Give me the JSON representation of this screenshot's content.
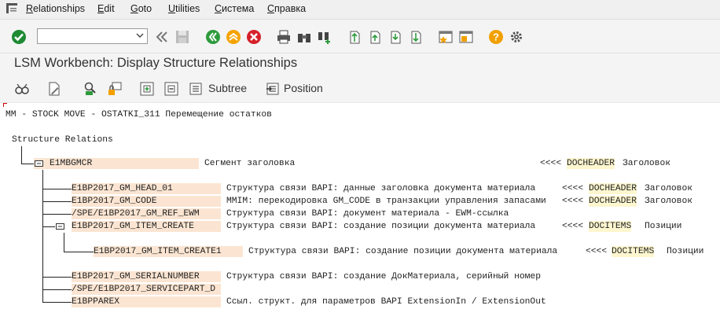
{
  "menu": {
    "items": [
      "Relationships",
      "Edit",
      "Goto",
      "Utilities",
      "Система",
      "Справка"
    ]
  },
  "toolbar": {
    "command_field": ""
  },
  "page": {
    "title": "LSM Workbench: Display Structure Relationships"
  },
  "app_toolbar": {
    "subtree_label": "Subtree",
    "position_label": "Position"
  },
  "content": {
    "header": "MM - STOCK MOVE - OSTATKI_311 Перемещение остатков",
    "section_title": "Structure Relations",
    "root": {
      "name": "E1MBGMCR",
      "desc": "Сегмент заголовка",
      "arrow": "<<<<",
      "target": "DOCHEADER",
      "target_desc": "Заголовок"
    },
    "children": [
      {
        "name": "E1BP2017_GM_HEAD_01",
        "desc": "Структура связи BAPI: данные заголовка документа материала",
        "arrow": "<<<<",
        "target": "DOCHEADER",
        "target_desc": "Заголовок"
      },
      {
        "name": "E1BP2017_GM_CODE",
        "desc": "MMIM: перекодировка GM_CODE в транзакции управления запасами",
        "arrow": "<<<<",
        "target": "DOCHEADER",
        "target_desc": "Заголовок"
      },
      {
        "name": "/SPE/E1BP2017_GM_REF_EWM",
        "desc": "Структура связи BAPI: документ материала - EWM-ссылка",
        "arrow": "",
        "target": "",
        "target_desc": ""
      },
      {
        "name": "E1BP2017_GM_ITEM_CREATE",
        "desc": "Структура связи BAPI: создание позиции документа материала",
        "arrow": "<<<<",
        "target": "DOCITEMS",
        "target_desc": "Позиции"
      },
      {
        "name": "E1BP2017_GM_ITEM_CREATE1",
        "desc": "Структура связи BAPI: создание позиции документа материала",
        "arrow": "<<<<",
        "target": "DOCITEMS",
        "target_desc": "Позиции"
      },
      {
        "name": "E1BP2017_GM_SERIALNUMBER",
        "desc": "Структура связи BAPI: создание ДокМатериала, серийный номер",
        "arrow": "",
        "target": "",
        "target_desc": ""
      },
      {
        "name": "/SPE/E1BP2017_SERVICEPART_D",
        "desc": "",
        "arrow": "",
        "target": "",
        "target_desc": ""
      },
      {
        "name": "E1BPPAREX",
        "desc": "Ссыл. структ. для параметров BAPI ExtensionIn / ExtensionOut",
        "arrow": "",
        "target": "",
        "target_desc": ""
      }
    ]
  },
  "colors": {
    "segment_bg": "#fbe5d2",
    "target_bg": "#fdf6cf",
    "ok_green": "#1e8a34",
    "back_green": "#2d9b3c",
    "exit_orange": "#f5a300",
    "cancel_red": "#d6202a",
    "help_orange": "#f2a000"
  }
}
